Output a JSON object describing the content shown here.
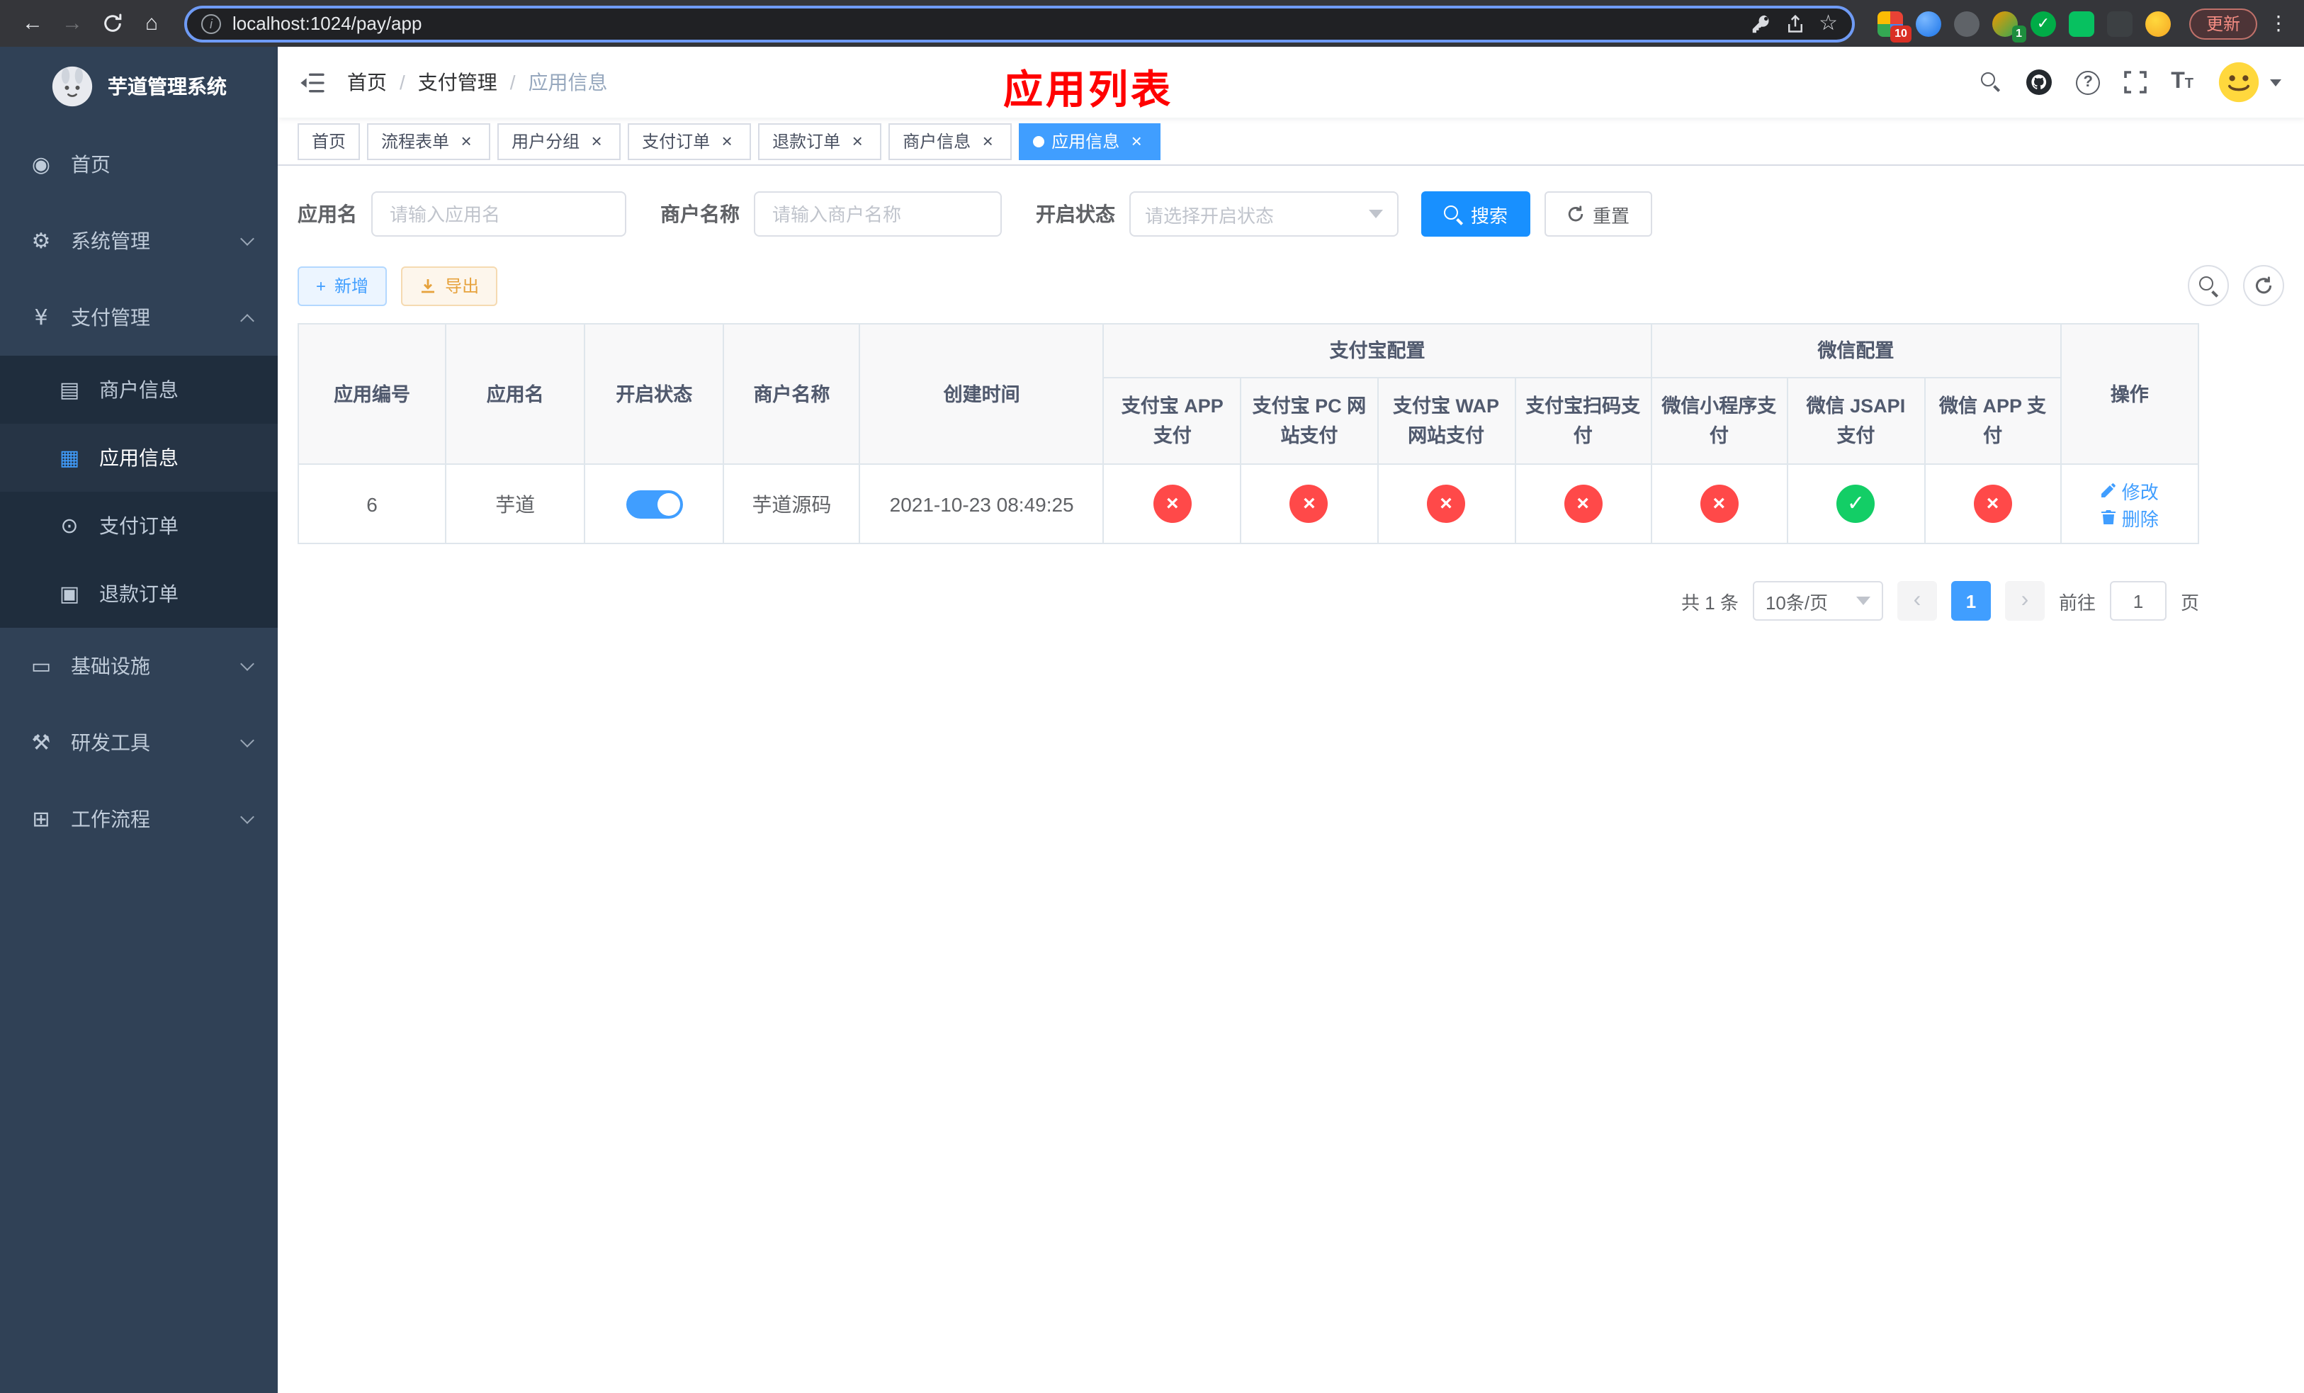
{
  "browser": {
    "url": "localhost:1024/pay/app",
    "update_label": "更新",
    "extension_badge": "10",
    "profile_badge": "1"
  },
  "glyphs": {
    "dashboard": "◉",
    "gear": "⚙",
    "yen": "¥",
    "card": "▤",
    "grid": "▦",
    "order": "⊙",
    "doc": "▣",
    "monitor": "▭",
    "tools": "⚒",
    "work": "⊞",
    "home": "⌂",
    "back": "←",
    "forward": "→",
    "star": "☆",
    "info": "i",
    "question": "?",
    "dots": "⋮",
    "cross": "×",
    "check": "✓",
    "close": "×",
    "plus": "+",
    "prev": "‹",
    "next": "›",
    "tsize_big": "T",
    "tsize_small": "T"
  },
  "sidebar": {
    "title": "芋道管理系统",
    "items": {
      "home": "首页",
      "system": "系统管理",
      "payment": "支付管理",
      "infra": "基础设施",
      "devtools": "研发工具",
      "workflow": "工作流程"
    },
    "payment_children": {
      "merchant": "商户信息",
      "app": "应用信息",
      "order": "支付订单",
      "refund": "退款订单"
    }
  },
  "navbar": {
    "breadcrumb": {
      "home": "首页",
      "section": "支付管理",
      "current": "应用信息",
      "separator": "/"
    },
    "page_title": "应用列表"
  },
  "tabs": [
    {
      "label": "首页",
      "active": false,
      "closable": false
    },
    {
      "label": "流程表单",
      "active": false,
      "closable": true
    },
    {
      "label": "用户分组",
      "active": false,
      "closable": true
    },
    {
      "label": "支付订单",
      "active": false,
      "closable": true
    },
    {
      "label": "退款订单",
      "active": false,
      "closable": true
    },
    {
      "label": "商户信息",
      "active": false,
      "closable": true
    },
    {
      "label": "应用信息",
      "active": true,
      "closable": true
    }
  ],
  "filters": {
    "app_name_label": "应用名",
    "app_name_placeholder": "请输入应用名",
    "merchant_label": "商户名称",
    "merchant_placeholder": "请输入商户名称",
    "status_label": "开启状态",
    "status_placeholder": "请选择开启状态",
    "search_label": "搜索",
    "reset_label": "重置"
  },
  "toolbar": {
    "add_label": "新增",
    "export_label": "导出"
  },
  "table": {
    "headers": {
      "app_id": "应用编号",
      "app_name": "应用名",
      "status": "开启状态",
      "merchant_name": "商户名称",
      "create_time": "创建时间",
      "alipay_group": "支付宝配置",
      "wechat_group": "微信配置",
      "alipay_app": "支付宝 APP 支付",
      "alipay_pc": "支付宝 PC 网站支付",
      "alipay_wap": "支付宝 WAP 网站支付",
      "alipay_qr": "支付宝扫码支付",
      "wechat_lite": "微信小程序支付",
      "wechat_jsapi": "微信 JSAPI 支付",
      "wechat_app": "微信 APP 支付",
      "actions": "操作"
    },
    "rows": [
      {
        "app_id": "6",
        "app_name": "芋道",
        "status_enabled": true,
        "merchant_name": "芋道源码",
        "create_time": "2021-10-23 08:49:25",
        "channels": {
          "alipay_app": false,
          "alipay_pc": false,
          "alipay_wap": false,
          "alipay_qr": false,
          "wechat_lite": false,
          "wechat_jsapi": true,
          "wechat_app": false
        },
        "edit_label": "修改",
        "delete_label": "删除"
      }
    ]
  },
  "pagination": {
    "total_label": "共 1 条",
    "page_size_label": "10条/页",
    "current_page": "1",
    "goto_label": "前往",
    "goto_value": "1",
    "goto_unit": "页"
  },
  "colors": {
    "primary": "#409eff",
    "search_button": "#1890ff",
    "danger": "#ff4949",
    "success": "#13ce66",
    "warning": "#e6a23c",
    "sidebar_bg": "#304156",
    "submenu_bg": "#1f2d3d",
    "page_title_red": "#ff0000"
  }
}
